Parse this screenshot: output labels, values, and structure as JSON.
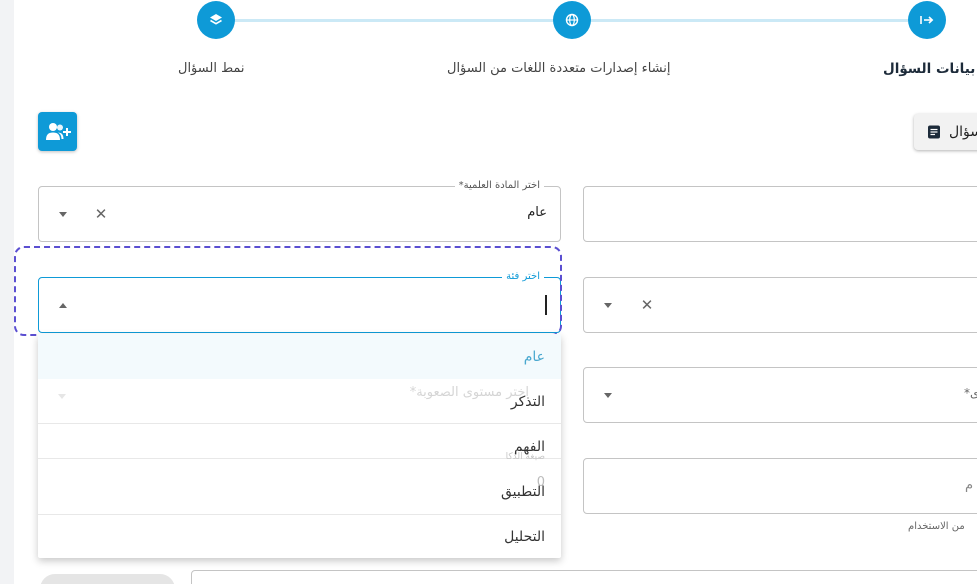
{
  "stepper": {
    "steps": [
      {
        "label": "بيانات السؤال",
        "icon": "arrow-right-to-bar-icon",
        "active": true
      },
      {
        "label": "إنشاء إصدارات متعددة اللغات من السؤال",
        "icon": "globe-icon",
        "active": false
      },
      {
        "label": "نمط السؤال",
        "icon": "layers-icon",
        "active": false
      }
    ]
  },
  "toolbar": {
    "doc_button_label": "سؤال"
  },
  "subject_field": {
    "label": "اختر المادة العلمية*",
    "value": "عام"
  },
  "category_field": {
    "label": "اختر فئة",
    "value": ""
  },
  "difficulty_field": {
    "label": "اختر مستوى الصعوبة*"
  },
  "right_select_label": "ى*",
  "right_input_text": "م",
  "ghost_small_label": "صيغة الذكا",
  "ghost_digit": "0",
  "usage_hint": "من الاستخدام",
  "dropdown": {
    "options": [
      "عام",
      "التذكر",
      "الفهم",
      "التطبيق",
      "التحليل"
    ],
    "selected_index": 0
  },
  "colors": {
    "accent": "#0e9ad7",
    "highlight": "#5b4fd1"
  }
}
